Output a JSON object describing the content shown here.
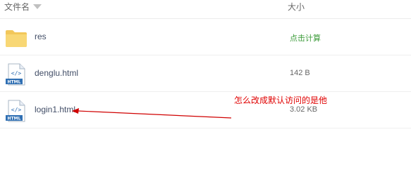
{
  "header": {
    "name_label": "文件名",
    "size_label": "大小"
  },
  "files": [
    {
      "name": "res",
      "size": "点击计算",
      "icon": "folder-icon",
      "size_is_action": true
    },
    {
      "name": "denglu.html",
      "size": "142 B",
      "icon": "html-file-icon",
      "size_is_action": false
    },
    {
      "name": "login1.html",
      "size": "3.02 KB",
      "icon": "html-file-icon",
      "size_is_action": false
    }
  ],
  "icon_label": "HTML",
  "annotation": {
    "text": "怎么改成默认访问的是他",
    "color": "#e00000"
  },
  "colors": {
    "action_green": "#3f9c3c",
    "folder_yellow": "#f8d775",
    "html_blue": "#2f6fb3"
  }
}
